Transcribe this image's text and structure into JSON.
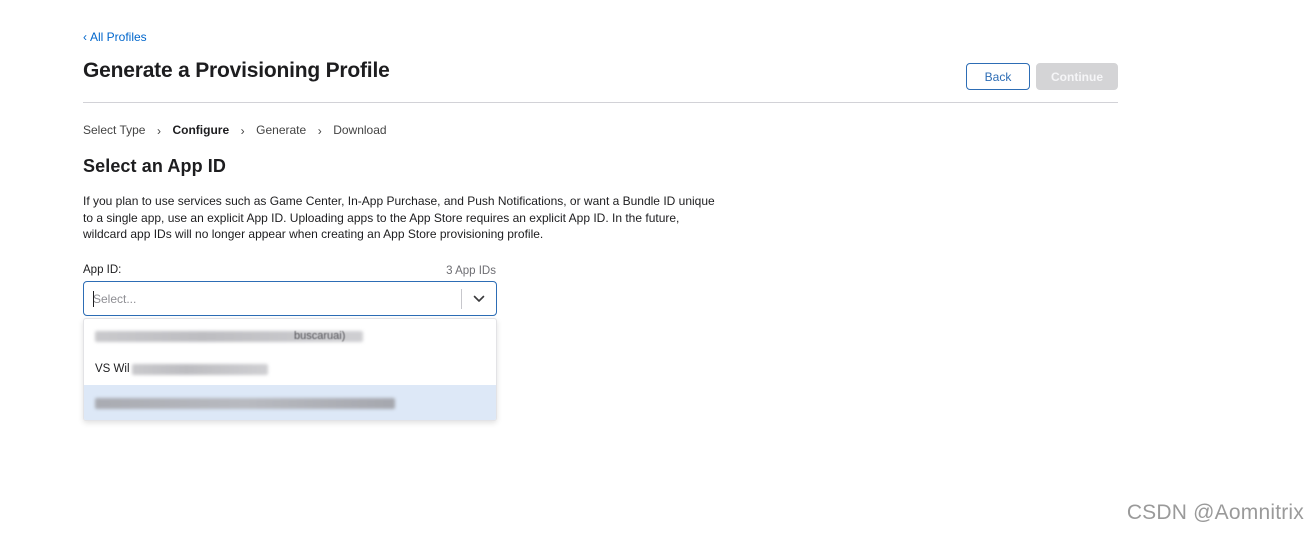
{
  "header": {
    "back_link": "All Profiles",
    "title": "Generate a Provisioning Profile",
    "back_button": "Back",
    "continue_button": "Continue"
  },
  "steps": [
    {
      "label": "Select Type",
      "active": false
    },
    {
      "label": "Configure",
      "active": true
    },
    {
      "label": "Generate",
      "active": false
    },
    {
      "label": "Download",
      "active": false
    }
  ],
  "section": {
    "title": "Select an App ID",
    "description_lines": [
      "If you plan to use services such as Game Center, In-App Purchase, and Push Notifications, or want a Bundle ID unique",
      "to a single app, use an explicit App ID. Uploading apps to the App Store requires an explicit App ID. In the future,",
      "wildcard app IDs will no longer appear when creating an App Store provisioning profile."
    ]
  },
  "app_id_field": {
    "label": "App ID:",
    "count": "3 App IDs",
    "placeholder": "Select...",
    "value": ""
  },
  "dropdown": {
    "options": [
      {
        "visible_text": "",
        "redacted_tail": "buscaruai)",
        "highlighted": false
      },
      {
        "visible_text": "VS Wil",
        "redacted_tail": "",
        "highlighted": false
      },
      {
        "visible_text": "",
        "redacted_tail": "",
        "highlighted": true
      }
    ]
  },
  "watermark": "CSDN @Aomnitrix",
  "colors": {
    "accent": "#2d6db5",
    "link": "#0066cc",
    "disabled_button": "#d4d4d6",
    "highlight_row": "#dde8f7",
    "divider": "#d2d2d7"
  }
}
